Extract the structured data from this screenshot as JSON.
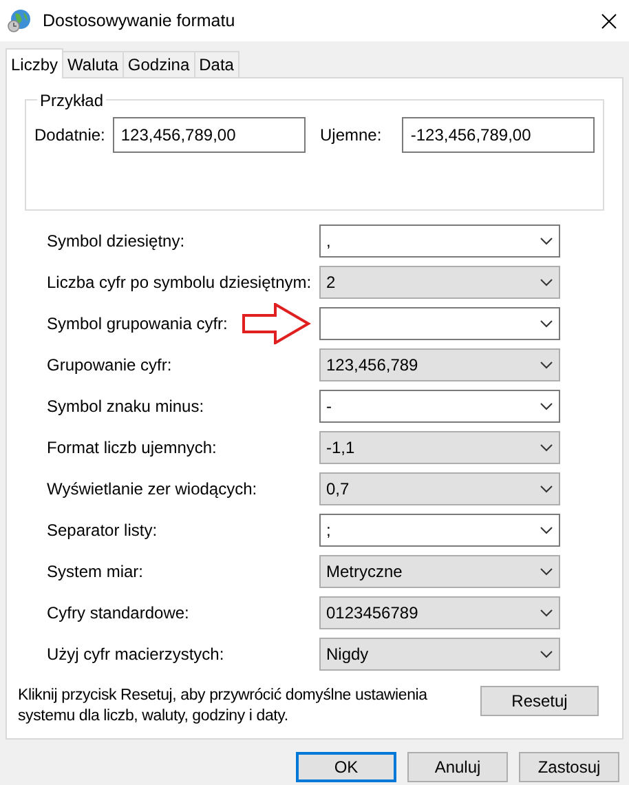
{
  "window": {
    "title": "Dostosowywanie formatu"
  },
  "tabs": [
    {
      "label": "Liczby",
      "selected": true
    },
    {
      "label": "Waluta",
      "selected": false
    },
    {
      "label": "Godzina",
      "selected": false
    },
    {
      "label": "Data",
      "selected": false
    }
  ],
  "example": {
    "title": "Przykład",
    "positive_label": "Dodatnie:",
    "positive_value": "123,456,789,00",
    "negative_label": "Ujemne:",
    "negative_value": "-123,456,789,00"
  },
  "settings": [
    {
      "label": "Symbol dziesiętny:",
      "value": ",",
      "kind": "editable",
      "marked": false
    },
    {
      "label": "Liczba cyfr po symbolu dziesiętnym:",
      "value": "2",
      "kind": "list",
      "marked": false
    },
    {
      "label": "Symbol grupowania cyfr:",
      "kind": "editable",
      "marked": true
    },
    {
      "label": "Grupowanie cyfr:",
      "value": "123,456,789",
      "kind": "list",
      "marked": false
    },
    {
      "label": "Symbol znaku minus:",
      "value": "-",
      "kind": "editable",
      "marked": false
    },
    {
      "label": "Format liczb ujemnych:",
      "value": "-1,1",
      "kind": "list",
      "marked": false
    },
    {
      "label": "Wyświetlanie zer wiodących:",
      "value": "0,7",
      "kind": "list",
      "marked": false
    },
    {
      "label": "Separator listy:",
      "value": ";",
      "kind": "editable",
      "marked": false
    },
    {
      "label": "System miar:",
      "value": "Metryczne",
      "kind": "list",
      "marked": false
    },
    {
      "label": "Cyfry standardowe:",
      "value": "0123456789",
      "kind": "list",
      "marked": false
    },
    {
      "label": "Użyj cyfr macierzystych:",
      "value": "Nigdy",
      "kind": "list",
      "marked": false
    }
  ],
  "reset": {
    "text": "Kliknij przycisk Resetuj, aby przywrócić domyślne ustawienia systemu dla liczb, waluty, godziny i daty.",
    "button": "Resetuj"
  },
  "buttons": [
    {
      "label": "OK",
      "default": true
    },
    {
      "label": "Anuluj",
      "default": false
    },
    {
      "label": "Zastosuj",
      "default": false
    }
  ]
}
